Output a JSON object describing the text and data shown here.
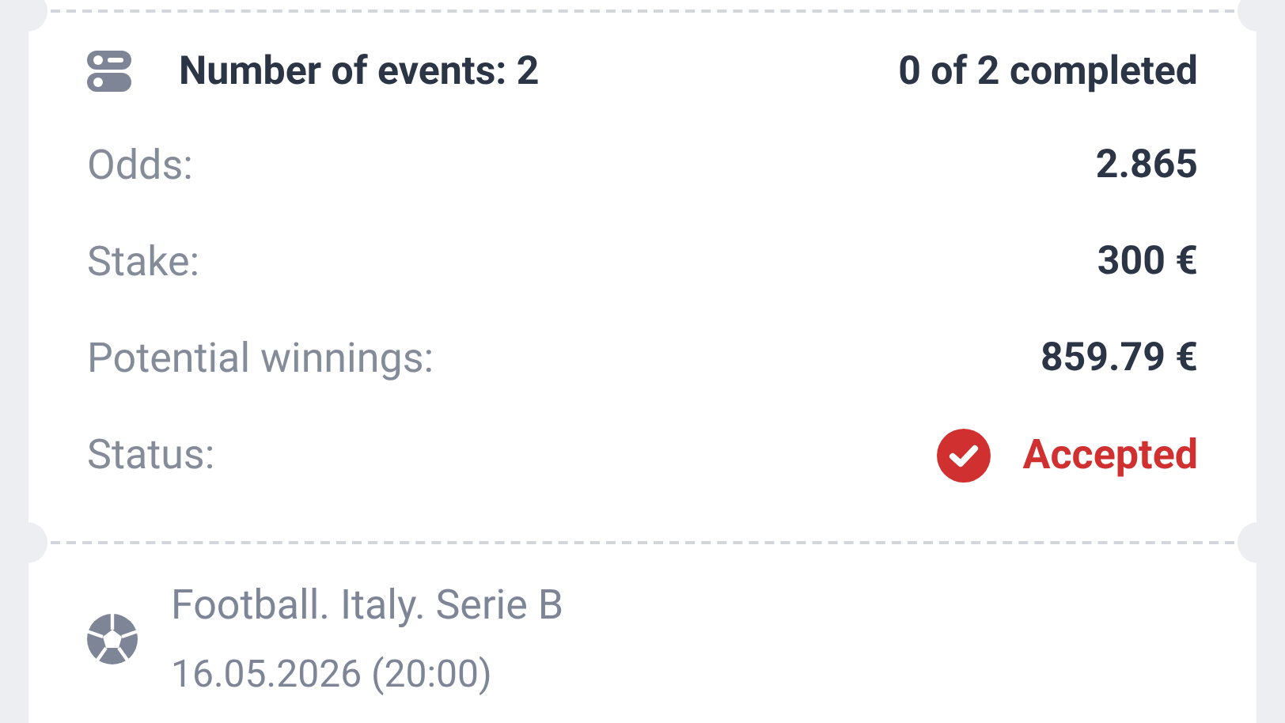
{
  "summary": {
    "events_label": "Number of events: 2",
    "progress": "0 of 2 completed"
  },
  "details": [
    {
      "label": "Odds:",
      "value": "2.865"
    },
    {
      "label": "Stake:",
      "value": "300 €"
    },
    {
      "label": "Potential winnings:",
      "value": "859.79 €"
    }
  ],
  "status": {
    "label": "Status:",
    "value": "Accepted",
    "kind": "accepted"
  },
  "event": {
    "sport": "Football. Italy. Serie B",
    "date": "16.05.2026 (20:00)"
  }
}
